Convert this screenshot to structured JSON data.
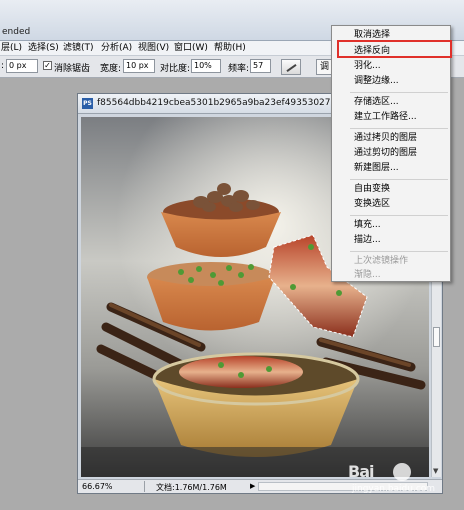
{
  "app": {
    "title_fragment": "ended"
  },
  "menubar": {
    "items": [
      "层(L)",
      "选择(S)",
      "滤镜(T)",
      "分析(A)",
      "视图(V)",
      "窗口(W)",
      "帮助(H)"
    ]
  },
  "options": {
    "feather_value": "0 px",
    "antialias_label": "消除锯齿",
    "antialias_checked": "✓",
    "width_label": "宽度:",
    "width_value": "10 px",
    "contrast_label": "对比度:",
    "contrast_value": "10%",
    "frequency_label": "频率:",
    "frequency_value": "57",
    "refine_button": "调"
  },
  "document": {
    "icon_label": "PS",
    "title": "f85564dbb4219cbea5301b2965a9ba23ef49353027178-mK",
    "zoom": "66.67%",
    "doc_info": "文档:1.76M/1.76M"
  },
  "context_menu": {
    "items": [
      {
        "label": "取消选择",
        "enabled": true
      },
      {
        "label": "选择反向",
        "enabled": true,
        "highlighted": true
      },
      {
        "label": "羽化...",
        "enabled": true
      },
      {
        "label": "调整边缘...",
        "enabled": true
      },
      {
        "label": "存储选区...",
        "enabled": true
      },
      {
        "label": "建立工作路径...",
        "enabled": true
      },
      {
        "label": "通过拷贝的图层",
        "enabled": true
      },
      {
        "label": "通过剪切的图层",
        "enabled": true
      },
      {
        "label": "新建图层...",
        "enabled": true
      },
      {
        "label": "自由变换",
        "enabled": true
      },
      {
        "label": "变换选区",
        "enabled": true
      },
      {
        "label": "填充...",
        "enabled": true
      },
      {
        "label": "描边...",
        "enabled": true
      },
      {
        "label": "上次滤镜操作",
        "enabled": false
      },
      {
        "label": "渐隐...",
        "enabled": false
      }
    ]
  },
  "watermark": {
    "logo": "Bai",
    "sub": "jingyan.baidu.com"
  },
  "colors": {
    "highlight": "#e0302a",
    "menu_bg": "#f3f3f3"
  }
}
